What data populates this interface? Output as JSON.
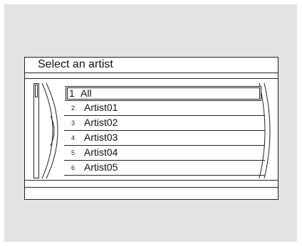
{
  "screen": {
    "title": "Select an artist"
  },
  "list": {
    "items": [
      {
        "number": "1",
        "label": "All",
        "selected": true
      },
      {
        "number": "2",
        "label": "Artist01",
        "selected": false
      },
      {
        "number": "3",
        "label": "Artist02",
        "selected": false
      },
      {
        "number": "4",
        "label": "Artist03",
        "selected": false
      },
      {
        "number": "5",
        "label": "Artist04",
        "selected": false
      },
      {
        "number": "6",
        "label": "Artist05",
        "selected": false
      }
    ]
  },
  "colors": {
    "backdrop": "#e3e3e3",
    "screen": "#ffffff",
    "line": "#222222"
  }
}
